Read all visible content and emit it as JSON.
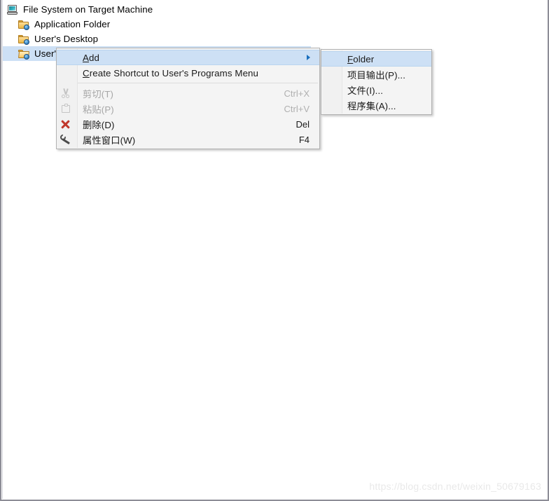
{
  "tree": {
    "items": [
      {
        "label": "File System on Target Machine",
        "icon": "computer-icon",
        "level": 0,
        "selected": false
      },
      {
        "label": "Application Folder",
        "icon": "folder-icon",
        "level": 1,
        "selected": false
      },
      {
        "label": "User's Desktop",
        "icon": "folder-icon",
        "level": 1,
        "selected": false
      },
      {
        "label": "User's Programs Menu",
        "icon": "folder-open-icon",
        "level": 1,
        "selected": true
      }
    ]
  },
  "context_menu": {
    "items": [
      {
        "label": "Add",
        "accel": "A",
        "shortcut": "",
        "icon": "",
        "disabled": false,
        "highlight": true,
        "has_submenu": true
      },
      {
        "label": "Create Shortcut to User's Programs Menu",
        "accel": "C",
        "shortcut": "",
        "icon": "",
        "disabled": false,
        "highlight": false,
        "has_submenu": false
      },
      {
        "separator": true
      },
      {
        "label": "剪切(T)",
        "accel": "T",
        "shortcut": "Ctrl+X",
        "icon": "cut-icon",
        "disabled": true,
        "highlight": false,
        "has_submenu": false
      },
      {
        "label": "粘贴(P)",
        "accel": "P",
        "shortcut": "Ctrl+V",
        "icon": "paste-icon",
        "disabled": true,
        "highlight": false,
        "has_submenu": false
      },
      {
        "label": "删除(D)",
        "accel": "D",
        "shortcut": "Del",
        "icon": "delete-icon",
        "disabled": false,
        "highlight": false,
        "has_submenu": false
      },
      {
        "label": "属性窗口(W)",
        "accel": "W",
        "shortcut": "F4",
        "icon": "wrench-icon",
        "disabled": false,
        "highlight": false,
        "has_submenu": false
      }
    ]
  },
  "submenu": {
    "items": [
      {
        "label": "Folder",
        "accel": "F",
        "highlight": true
      },
      {
        "label": "项目输出(P)...",
        "accel": "P",
        "highlight": false
      },
      {
        "label": "文件(I)...",
        "accel": "I",
        "highlight": false
      },
      {
        "label": "程序集(A)...",
        "accel": "A",
        "highlight": false
      }
    ]
  },
  "watermark": {
    "text": "https://blog.csdn.net/weixin_50679163"
  },
  "colors": {
    "selection": "#cde0f5",
    "menu_bg": "#f4f4f4",
    "menu_border": "#b2b2b2",
    "delete_icon": "#c0372b",
    "submenu_arrow": "#1a6fbd",
    "disabled_text": "#a7a7a7"
  }
}
